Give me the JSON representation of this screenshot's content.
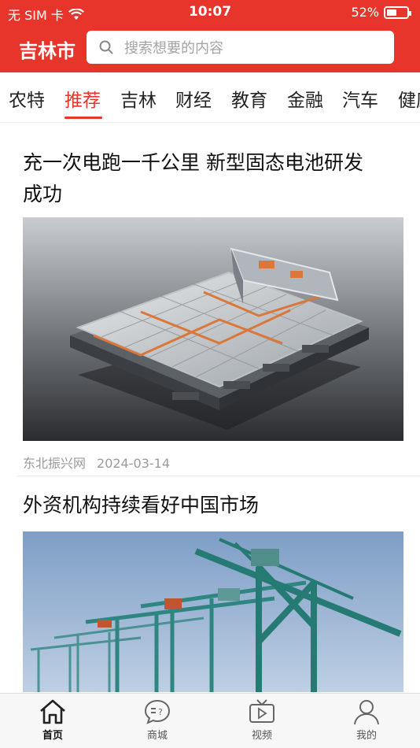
{
  "status_bar": {
    "carrier": "无 SIM 卡",
    "time": "10:07",
    "battery": "52%",
    "battery_level": 0.52,
    "icons": [
      "wifi-icon",
      "battery-icon"
    ]
  },
  "header": {
    "city": "吉林市",
    "search_placeholder": "搜索想要的内容",
    "brand_color": "#e8352b"
  },
  "tabs": [
    {
      "label": "农特"
    },
    {
      "label": "推荐",
      "active": true
    },
    {
      "label": "吉林"
    },
    {
      "label": "财经"
    },
    {
      "label": "教育"
    },
    {
      "label": "金融"
    },
    {
      "label": "汽车"
    },
    {
      "label": "健康"
    }
  ],
  "articles": [
    {
      "title_line1": "充一次电跑一千公里 新型固态电池研发",
      "title_line2": "成功",
      "source": "东北振兴网",
      "date": "2024-03-14",
      "image": "ev-battery-pack"
    },
    {
      "title_line1": "外资机构持续看好中国市场",
      "image": "port-cranes"
    }
  ],
  "bottom_nav": [
    {
      "label": "首页",
      "icon": "home-icon",
      "active": true
    },
    {
      "label": "商城",
      "icon": "chat-bubble-icon"
    },
    {
      "label": "视频",
      "icon": "tv-icon"
    },
    {
      "label": "我的",
      "icon": "user-icon"
    }
  ]
}
